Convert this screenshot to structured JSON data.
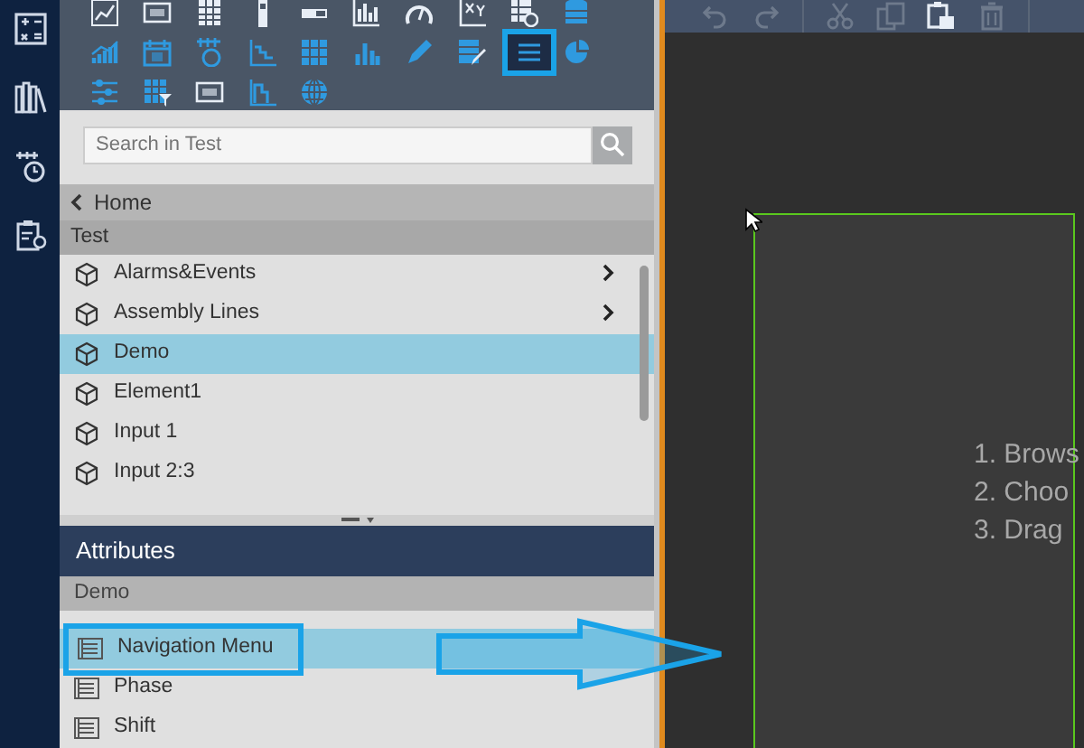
{
  "palette": [
    {
      "selected": false
    },
    {
      "selected": false
    },
    {
      "selected": false
    },
    {
      "selected": false
    },
    {
      "selected": false
    },
    {
      "selected": false
    },
    {
      "selected": false
    },
    {
      "selected": false
    },
    {
      "selected": false
    },
    {
      "selected": false
    },
    {
      "selected": false
    },
    {
      "selected": false
    },
    {
      "selected": false
    },
    {
      "selected": false
    },
    {
      "selected": false
    },
    {
      "selected": false
    },
    {
      "selected": false
    },
    {
      "selected": false
    },
    {
      "selected": true
    },
    {
      "selected": false
    },
    {
      "selected": false
    },
    {
      "selected": false
    },
    {
      "selected": false
    },
    {
      "selected": false
    },
    {
      "selected": false
    }
  ],
  "search": {
    "placeholder": "Search in Test"
  },
  "breadcrumb": {
    "back_label": "Home"
  },
  "elements": {
    "title": "Test",
    "items": [
      {
        "label": "Alarms&Events",
        "has_children": true,
        "selected": false
      },
      {
        "label": "Assembly Lines",
        "has_children": true,
        "selected": false
      },
      {
        "label": "Demo",
        "has_children": false,
        "selected": true
      },
      {
        "label": "Element1",
        "has_children": false,
        "selected": false
      },
      {
        "label": "Input 1",
        "has_children": false,
        "selected": false
      },
      {
        "label": "Input 2:3",
        "has_children": false,
        "selected": false
      }
    ]
  },
  "attributes": {
    "title": "Attributes",
    "subtitle": "Demo",
    "items": [
      {
        "label": "Navigation Menu",
        "selected": true
      },
      {
        "label": "Phase",
        "selected": false
      },
      {
        "label": "Shift",
        "selected": false
      }
    ]
  },
  "canvas": {
    "instructions": [
      "1. Brows",
      "2. Choo",
      "3. Drag"
    ]
  }
}
